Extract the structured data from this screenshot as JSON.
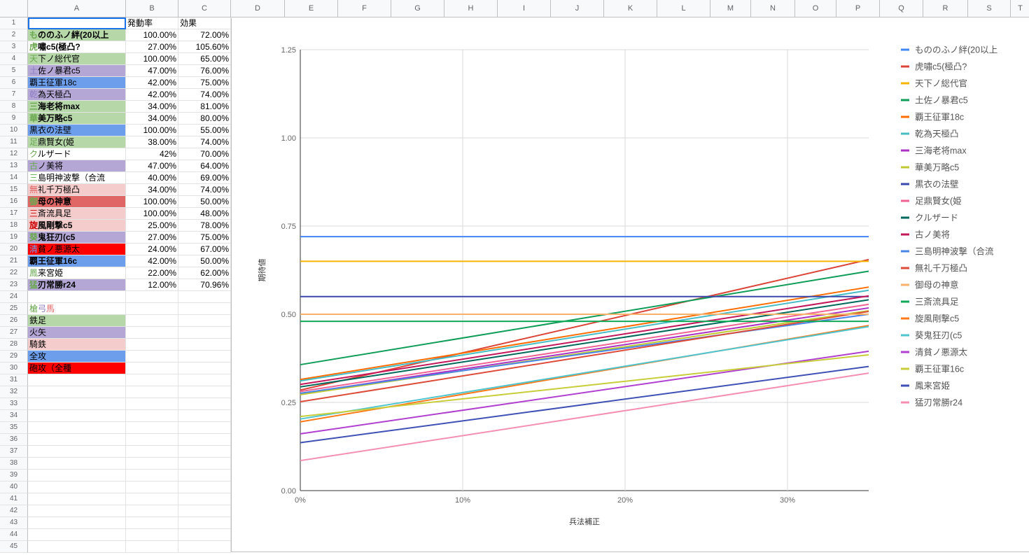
{
  "column_headers": [
    "A",
    "B",
    "C",
    "D",
    "E",
    "F",
    "G",
    "H",
    "I",
    "J",
    "K",
    "L",
    "M",
    "N",
    "O",
    "P",
    "Q",
    "R",
    "S",
    "T"
  ],
  "header_row": {
    "a": "",
    "b": "発動率",
    "c": "効果"
  },
  "rows": [
    {
      "name": "もののふノ絆(20以上",
      "rate": "100.00%",
      "effect": "72.00%",
      "fill": "#b6d7a8",
      "prefix_color": "#6aa84f",
      "bold": true
    },
    {
      "name": "虎嘯c5(極凸?",
      "rate": "27.00%",
      "effect": "105.60%",
      "fill": "#ffffff",
      "prefix_color": "#6aa84f",
      "bold": true
    },
    {
      "name": "天下ノ総代官",
      "rate": "100.00%",
      "effect": "65.00%",
      "fill": "#b6d7a8",
      "prefix_color": "#6aa84f",
      "bold": false
    },
    {
      "name": "土佐ノ暴君c5",
      "rate": "47.00%",
      "effect": "76.00%",
      "fill": "#b4a7d6",
      "prefix_color": "#8e7cc3",
      "bold": false
    },
    {
      "name": "覇王征軍18c",
      "rate": "42.00%",
      "effect": "75.00%",
      "fill": "#6d9eeb",
      "prefix_color": "#000000",
      "bold": false
    },
    {
      "name": "乾為天極凸",
      "rate": "42.00%",
      "effect": "74.00%",
      "fill": "#b4a7d6",
      "prefix_color": "#8e7cc3",
      "bold": false
    },
    {
      "name": "三海老将max",
      "rate": "34.00%",
      "effect": "81.00%",
      "fill": "#b6d7a8",
      "prefix_color": "#6aa84f",
      "bold": true
    },
    {
      "name": "華美万略c5",
      "rate": "34.00%",
      "effect": "80.00%",
      "fill": "#b6d7a8",
      "prefix_color": "#6aa84f",
      "bold": true
    },
    {
      "name": "黒衣の法壁",
      "rate": "100.00%",
      "effect": "55.00%",
      "fill": "#6d9eeb",
      "prefix_color": "#000000",
      "bold": false
    },
    {
      "name": "足鼎賢女(姫",
      "rate": "38.00%",
      "effect": "74.00%",
      "fill": "#b6d7a8",
      "prefix_color": "#6aa84f",
      "bold": false
    },
    {
      "name": "クルザード",
      "rate": "42%",
      "effect": "70.00%",
      "fill": "#ffffff",
      "prefix_color": "#6aa84f",
      "bold": false
    },
    {
      "name": "古ノ美将",
      "rate": "47.00%",
      "effect": "64.00%",
      "fill": "#b4a7d6",
      "prefix_color": "#6aa84f",
      "bold": false
    },
    {
      "name": "三島明神波撃（合流",
      "rate": "40.00%",
      "effect": "69.00%",
      "fill": "#ffffff",
      "prefix_color": "#6aa84f",
      "bold": false
    },
    {
      "name": "無礼千万極凸",
      "rate": "34.00%",
      "effect": "74.00%",
      "fill": "#f4cccc",
      "prefix_color": "#e06666",
      "bold": false
    },
    {
      "name": "御母の神意",
      "rate": "100.00%",
      "effect": "50.00%",
      "fill": "#e06666",
      "prefix_color": "#6aa84f",
      "bold": true
    },
    {
      "name": "三斎流具足",
      "rate": "100.00%",
      "effect": "48.00%",
      "fill": "#f4cccc",
      "prefix_color": "#cc0000",
      "bold": false
    },
    {
      "name": "旋風剛撃c5",
      "rate": "25.00%",
      "effect": "78.00%",
      "fill": "#f4cccc",
      "prefix_color": "#cc0000",
      "bold": true
    },
    {
      "name": "葵鬼狂刃(c5",
      "rate": "27.00%",
      "effect": "75.00%",
      "fill": "#b4a7d6",
      "prefix_color": "#6aa84f",
      "bold": true
    },
    {
      "name": "清貧ノ悪源太",
      "rate": "24.00%",
      "effect": "67.00%",
      "fill": "#ff0000",
      "prefix_color": "#6d9eeb",
      "bold": false
    },
    {
      "name": "覇王征軍16c",
      "rate": "42.00%",
      "effect": "50.00%",
      "fill": "#6d9eeb",
      "prefix_color": "#000000",
      "bold": true
    },
    {
      "name": "鳳来宮姫",
      "rate": "22.00%",
      "effect": "62.00%",
      "fill": "#ffffff",
      "prefix_color": "#6aa84f",
      "bold": false
    },
    {
      "name": "猛刃常勝r24",
      "rate": "12.00%",
      "effect": "70.96%",
      "fill": "#b4a7d6",
      "prefix_color": "#6aa84f",
      "bold": true
    }
  ],
  "key_header": {
    "a": "槍",
    "b": "弓",
    "c": "馬",
    "a_color": "#6aa84f",
    "b_color": "#8e7cc3",
    "c_color": "#e06666"
  },
  "key_rows": [
    {
      "label": "鉄足",
      "fill": "#b6d7a8"
    },
    {
      "label": "火矢",
      "fill": "#b4a7d6"
    },
    {
      "label": "騎鉄",
      "fill": "#f4cccc"
    },
    {
      "label": "全攻",
      "fill": "#6d9eeb"
    },
    {
      "label": "砲攻（全種",
      "fill": "#ff0000"
    }
  ],
  "row_numbers": 45,
  "chart_data": {
    "type": "line",
    "xlabel": "兵法補正",
    "ylabel": "期待値",
    "xlim": [
      0,
      0.35
    ],
    "ylim": [
      0,
      1.25
    ],
    "x_ticks": [
      "0%",
      "10%",
      "20%",
      "30%"
    ],
    "y_ticks": [
      "0.00",
      "0.25",
      "0.50",
      "0.75",
      "1.00",
      "1.25"
    ],
    "grid": true,
    "legend_position": "right",
    "series": [
      {
        "name": "もののふノ絆(20以上",
        "color": "#4285f4",
        "start": 0.72,
        "end": 0.72
      },
      {
        "name": "虎嘯c5(極凸?",
        "color": "#db4437",
        "start": 0.285,
        "end": 0.655
      },
      {
        "name": "天下ノ総代官",
        "color": "#f4b400",
        "start": 0.65,
        "end": 0.65
      },
      {
        "name": "土佐ノ暴君c5",
        "color": "#0f9d58",
        "start": 0.357,
        "end": 0.622
      },
      {
        "name": "覇王征軍18c",
        "color": "#ff6d00",
        "start": 0.315,
        "end": 0.577
      },
      {
        "name": "乾為天極凸",
        "color": "#46bdc6",
        "start": 0.311,
        "end": 0.568
      },
      {
        "name": "三海老将max",
        "color": "#ab30c4",
        "start": 0.275,
        "end": 0.518
      },
      {
        "name": "華美万略c5",
        "color": "#c0ca33",
        "start": 0.272,
        "end": 0.51
      },
      {
        "name": "黒衣の法壁",
        "color": "#3949ab",
        "start": 0.55,
        "end": 0.55
      },
      {
        "name": "足鼎賢女(姫",
        "color": "#f06292",
        "start": 0.281,
        "end": 0.528
      },
      {
        "name": "クルザード",
        "color": "#00695c",
        "start": 0.294,
        "end": 0.541
      },
      {
        "name": "古ノ美将",
        "color": "#c2185b",
        "start": 0.301,
        "end": 0.552
      },
      {
        "name": "三島明神波撃（合流",
        "color": "#4a86e8",
        "start": 0.276,
        "end": 0.5
      },
      {
        "name": "無礼千万極凸",
        "color": "#dd4b39",
        "start": 0.252,
        "end": 0.508
      },
      {
        "name": "御母の神意",
        "color": "#f6b26b",
        "start": 0.5,
        "end": 0.5
      },
      {
        "name": "三斎流具足",
        "color": "#10a957",
        "start": 0.48,
        "end": 0.48
      },
      {
        "name": "旋風剛撃c5",
        "color": "#ff7a1a",
        "start": 0.195,
        "end": 0.468
      },
      {
        "name": "葵鬼狂刃(c5",
        "color": "#4ec5cf",
        "start": 0.203,
        "end": 0.465
      },
      {
        "name": "清貧ノ悪源太",
        "color": "#b040d0",
        "start": 0.161,
        "end": 0.395
      },
      {
        "name": "覇王征軍16c",
        "color": "#c8ce3a",
        "start": 0.21,
        "end": 0.385
      },
      {
        "name": "鳳来宮姫",
        "color": "#3f51b5",
        "start": 0.136,
        "end": 0.352
      },
      {
        "name": "猛刃常勝r24",
        "color": "#f48fb1",
        "start": 0.085,
        "end": 0.333
      }
    ]
  }
}
